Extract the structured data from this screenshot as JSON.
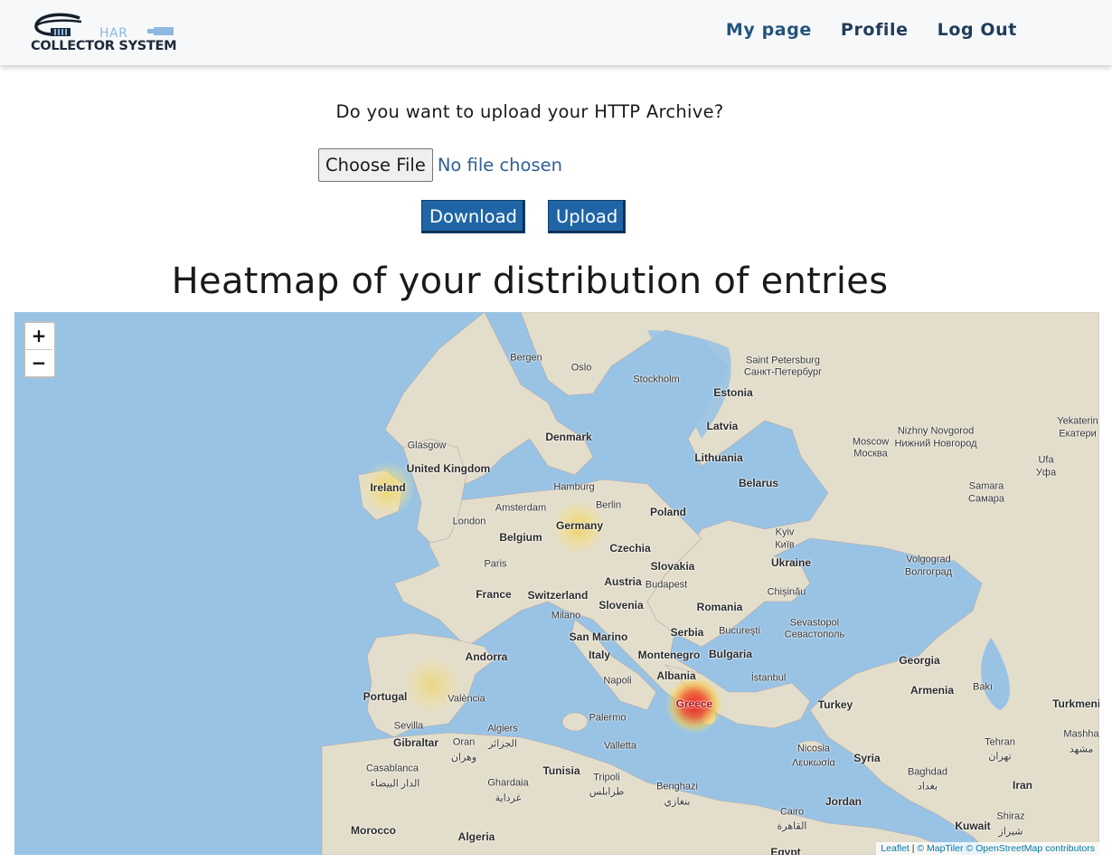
{
  "logo": {
    "top_text": "HAR",
    "bottom_text": "COLLECTOR SYSTEM"
  },
  "nav": {
    "items": [
      "My page",
      "Profile",
      "Log Out"
    ]
  },
  "upload": {
    "question": "Do you want to upload your HTTP Archive?",
    "choose_file_label": "Choose File",
    "file_status": "No file chosen",
    "download_label": "Download",
    "upload_label": "Upload"
  },
  "heatmap": {
    "title": "Heatmap of your distribution of entries",
    "zoom_in": "+",
    "zoom_out": "−",
    "attribution": {
      "leaflet": "Leaflet",
      "sep": " | ",
      "maptiler": "© MapTiler",
      "osm": "© OpenStreetMap contributors"
    },
    "hotspots": [
      {
        "label": "Ireland",
        "intensity": 0.45
      },
      {
        "label": "Germany",
        "intensity": 0.35
      },
      {
        "label": "Spain",
        "intensity": 0.25
      },
      {
        "label": "Greece",
        "intensity": 1.0
      }
    ],
    "country_labels": [
      "Ireland",
      "United Kingdom",
      "Denmark",
      "Belgium",
      "Germany",
      "Poland",
      "Czechia",
      "Slovakia",
      "Austria",
      "Switzerland",
      "France",
      "Slovenia",
      "Romania",
      "Serbia",
      "San Marino",
      "Italy",
      "Montenegro",
      "Bulgaria",
      "Albania",
      "Andorra",
      "Portugal",
      "Greece",
      "Turkey",
      "Gibraltar",
      "Tunisia",
      "Morocco",
      "Algeria",
      "Estonia",
      "Latvia",
      "Lithuania",
      "Belarus",
      "Ukraine",
      "Georgia",
      "Armenia",
      "Syria",
      "Jordan",
      "Iran",
      "Kuwait",
      "Egypt",
      "Turkmenist"
    ],
    "city_labels": [
      "Bergen",
      "Oslo",
      "Stockholm",
      "Saint Petersburg",
      "Санкт-Петербург",
      "Glasgow",
      "Hamburg",
      "Berlin",
      "Amsterdam",
      "London",
      "Paris",
      "Budapest",
      "Milano",
      "Chișinău",
      "Kyiv",
      "Київ",
      "Bucureşti",
      "Napoli",
      "İstanbul",
      "Palermo",
      "Valletta",
      "València",
      "Sevilla",
      "Algiers",
      "الجزائر",
      "Oran",
      "وهران",
      "Casablanca",
      "الدار البيضاء",
      "Ghardaia",
      "غرداية",
      "Tripoli",
      "طرابلس",
      "Benghazi",
      "بنغازي",
      "Nicosia",
      "Λευκωσία",
      "Sevastopol",
      "Севастополь",
      "Volgograd",
      "Волгоград",
      "Samara",
      "Самара",
      "Moscow",
      "Москва",
      "Nizhny Novgorod",
      "Нижний Новгород",
      "Ufa",
      "Уфа",
      "Yekaterin",
      "Екатери",
      "Bakı",
      "Tehran",
      "تهران",
      "Baghdad",
      "بغداد",
      "Cairo",
      "القاهرة",
      "Shiraz",
      "شیراز",
      "Mashha",
      "مشهد"
    ]
  }
}
